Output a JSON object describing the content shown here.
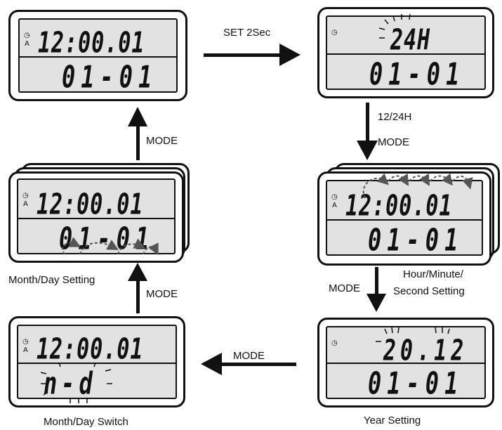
{
  "screens": {
    "s1": {
      "time": "12:00.01",
      "date": "01-01",
      "alarm": "A"
    },
    "s2": {
      "time": "24H",
      "date": "01-01"
    },
    "s3": {
      "time": "12:00.01",
      "date": "01-01",
      "alarm": "A"
    },
    "s4": {
      "time": "20.12",
      "date": "01-01"
    },
    "s5": {
      "time": "12:00.01",
      "date": "n-d",
      "alarm": "A"
    },
    "s6": {
      "time": "12:00.01",
      "date": "01-01",
      "alarm": "A"
    }
  },
  "labels": {
    "set_2sec": "SET 2Sec",
    "hour_mode_12_24": "12/24H",
    "mode_1": "MODE",
    "mode_2": "MODE",
    "mode_3": "MODE",
    "mode_4": "MODE",
    "mode_5": "MODE",
    "hms_line1": "Hour/Minute/",
    "hms_line2": "Second  Setting",
    "year_setting": "Year Setting",
    "month_day_switch": "Month/Day Switch",
    "month_day_setting": "Month/Day Setting"
  },
  "icons": {
    "clock": "clock-icon",
    "flash": "blink-rays-icon",
    "arrow": "arrow-icon"
  },
  "colors": {
    "lcd_bg": "#e2e2e2",
    "ink": "#111111",
    "dashed": "#666666"
  }
}
